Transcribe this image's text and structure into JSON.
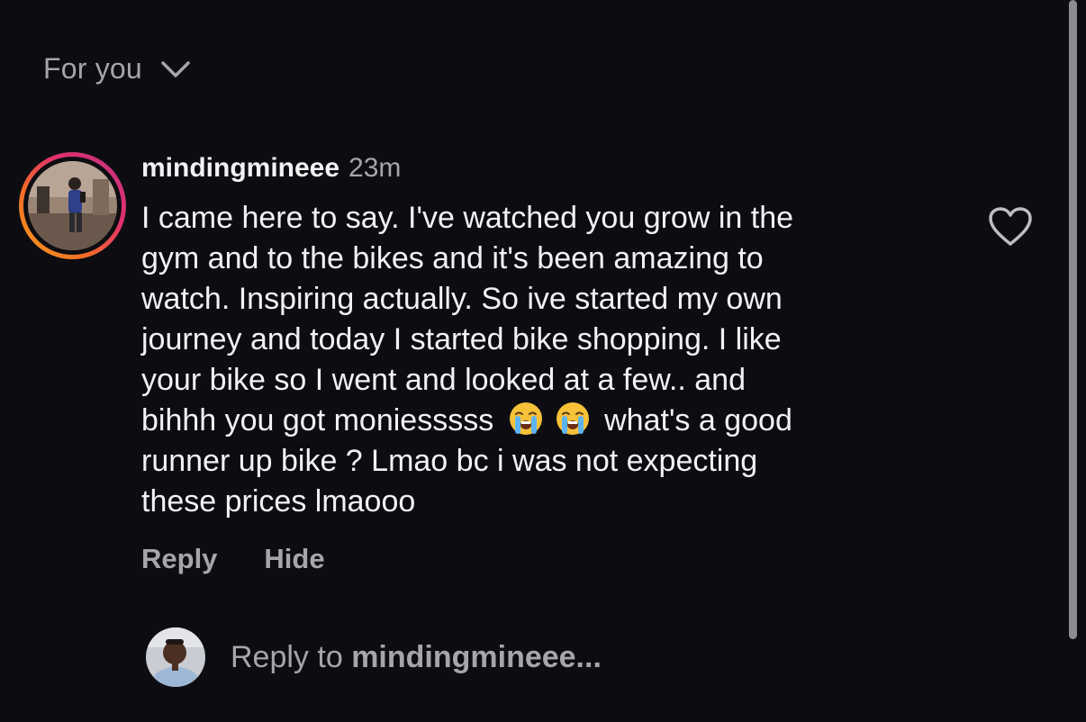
{
  "header": {
    "title": "For you",
    "chevron_icon": "chevron-down-icon"
  },
  "comment": {
    "username": "mindingmineee",
    "timestamp": "23m",
    "lines": [
      "I came here to say. I've watched you grow in the",
      "gym and to the bikes and it's been amazing to",
      "watch. Inspiring actually. So ive started my own",
      "journey and today I started bike shopping. I like",
      "your bike so I went and looked at a few.. and"
    ],
    "emoji_line": {
      "before": "bihhh you got moniesssss",
      "emojis": [
        "😭",
        "😭"
      ],
      "after": "what's a good"
    },
    "lines_end": [
      "runner up bike ? Lmao bc i was not expecting",
      "these prices lmaooo"
    ],
    "like_icon": "heart-outline-icon"
  },
  "actions": {
    "reply_label": "Reply",
    "hide_label": "Hide"
  },
  "reply_box": {
    "prefix": "Reply to ",
    "target": "mindingmineee..."
  },
  "colors": {
    "background": "#0d0d11",
    "primary_text": "#f2f2f4",
    "secondary_text": "#a5a5ab",
    "story_ring_start": "#f8a11b",
    "story_ring_end": "#c13584"
  }
}
